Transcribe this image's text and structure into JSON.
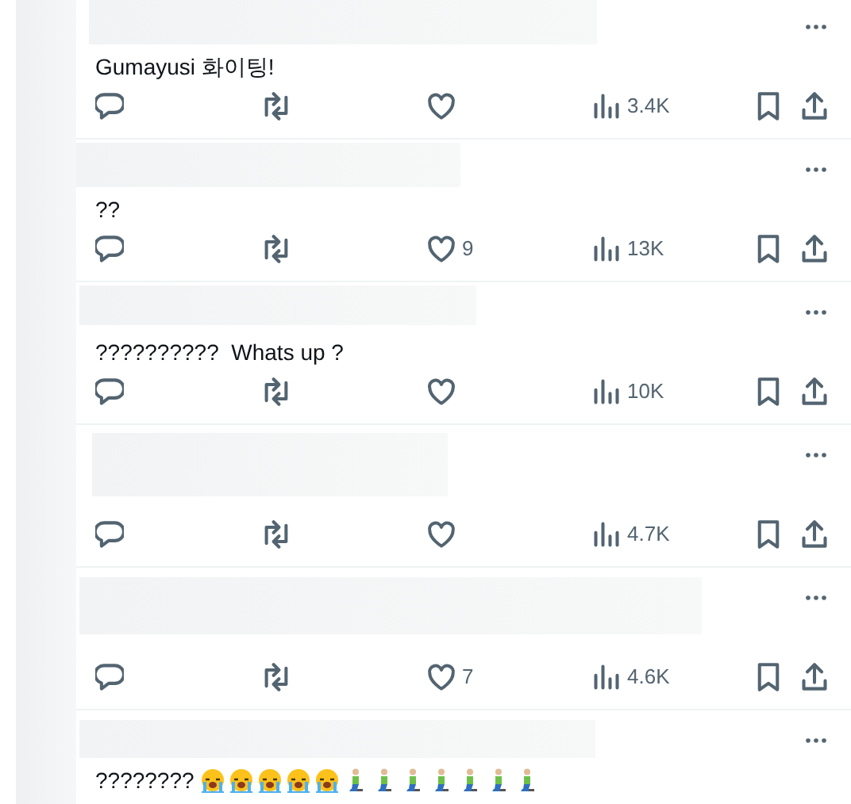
{
  "replies": [
    {
      "text": "Gumayusi 화이팅!",
      "views": "3.4K"
    },
    {
      "text": "??",
      "likes": "9",
      "views": "13K"
    },
    {
      "text": "??????????  Whats up ?",
      "views": "10K"
    },
    {
      "views": "4.7K"
    },
    {
      "likes": "7",
      "views": "4.6K"
    },
    {
      "text": "????????",
      "emoji": [
        {
          "kind": "crying-face"
        },
        {
          "kind": "crying-face"
        },
        {
          "kind": "crying-face"
        },
        {
          "kind": "crying-face"
        },
        {
          "kind": "crying-face"
        },
        {
          "kind": "kneeling-person"
        },
        {
          "kind": "kneeling-person"
        },
        {
          "kind": "kneeling-person"
        },
        {
          "kind": "kneeling-person"
        },
        {
          "kind": "kneeling-person"
        },
        {
          "kind": "kneeling-person"
        },
        {
          "kind": "kneeling-person"
        }
      ]
    }
  ]
}
